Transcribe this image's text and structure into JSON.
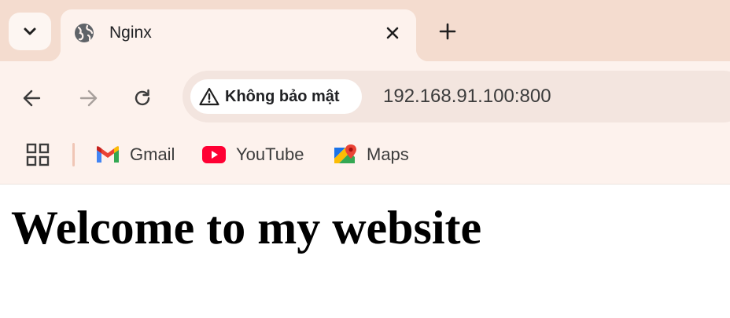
{
  "tab": {
    "title": "Nginx",
    "favicon": "globe-icon",
    "search_icon": "chevron-down-icon",
    "close_icon": "close-icon",
    "new_tab_icon": "plus-icon"
  },
  "toolbar": {
    "back_icon": "arrow-left-icon",
    "forward_icon": "arrow-right-icon",
    "reload_icon": "reload-icon"
  },
  "omnibox": {
    "security_label": "Không bảo mật",
    "security_icon": "warning-icon",
    "url": "192.168.91.100:800"
  },
  "bookmarks": {
    "apps_icon": "apps-grid-icon",
    "items": [
      {
        "label": "Gmail",
        "icon": "gmail-icon"
      },
      {
        "label": "YouTube",
        "icon": "youtube-icon"
      },
      {
        "label": "Maps",
        "icon": "maps-icon"
      }
    ]
  },
  "page": {
    "heading": "Welcome to my website"
  },
  "colors": {
    "tabstrip": "#f4dccf",
    "toolbar": "#fdf2ed",
    "omnibox": "#f3e5df",
    "page_background": "#ffffff"
  }
}
